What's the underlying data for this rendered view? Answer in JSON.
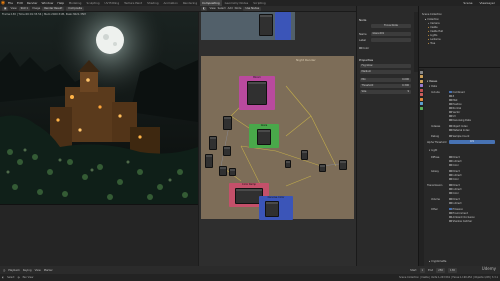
{
  "app": {
    "logo": "blender-logo",
    "menus": [
      "File",
      "Edit",
      "Render",
      "Window",
      "Help"
    ],
    "workspaces": [
      "Modeling",
      "Sculpting",
      "UV Editing",
      "Texture Paint",
      "Shading",
      "Animation",
      "Rendering",
      "Compositing",
      "Geometry Nodes",
      "Scripting"
    ],
    "active_workspace": "Compositing",
    "scene": "Scene",
    "view_layer": "ViewLayer"
  },
  "viewport": {
    "toolbar": [
      "View",
      "Slot 1",
      "Image",
      "Render Result"
    ],
    "mode_items": [
      "Composite"
    ],
    "info": "Frame:130 | Time:00:01:33.54 | Mem:2400.51M, Peak:3621.35M"
  },
  "node_editor": {
    "header_items": [
      "View",
      "Select",
      "Add",
      "Node",
      "Use Nodes"
    ],
    "breadcrumb": "Scene > Compositing Node Tree",
    "canvas_label": "Night Render",
    "frames": [
      {
        "title": "Bloom",
        "color": "#b94a9e"
      },
      {
        "title": "Glare",
        "color": "#49a84a"
      },
      {
        "title": "Color Ramp",
        "color": "#c4506a"
      },
      {
        "title": "Denoise Color",
        "color": "#3b55b8"
      }
    ]
  },
  "n_panel": {
    "node_section": "Node",
    "name_label": "Name",
    "name_value": "Glare.001",
    "label_label": "Label",
    "label_value": "",
    "color_label": "Color",
    "properties_section": "Properties",
    "fields": [
      {
        "label": "Fog Glow",
        "value": ""
      },
      {
        "label": "Medium",
        "value": ""
      },
      {
        "label": "Mix",
        "value": "0.000"
      },
      {
        "label": "Threshold",
        "value": "0.300"
      },
      {
        "label": "Size",
        "value": "9"
      }
    ],
    "focus_btn": "Focus Node"
  },
  "outliner": {
    "title": "Scene Collection",
    "rows": [
      "Collection",
      "Camera",
      "Castle",
      "Castle Hall",
      "Lights",
      "Lanterns",
      "Tree"
    ]
  },
  "properties": {
    "header": "Passes",
    "data_label": "Data",
    "include_label": "Include",
    "include": [
      {
        "label": "Combined",
        "on": true
      },
      {
        "label": "Z",
        "on": false
      },
      {
        "label": "Mist",
        "on": false
      },
      {
        "label": "Position",
        "on": false
      },
      {
        "label": "Normal",
        "on": false
      },
      {
        "label": "Vector",
        "on": false
      },
      {
        "label": "UV",
        "on": false
      },
      {
        "label": "Denoising Data",
        "on": false
      }
    ],
    "indexes_label": "Indexes",
    "indexes": [
      {
        "label": "Object Index",
        "on": false
      },
      {
        "label": "Material Index",
        "on": false
      }
    ],
    "debug_label": "Debug",
    "debug_value": "Sample Count",
    "alpha_label": "Alpha Threshold",
    "alpha_value": "0.5",
    "light_label": "Light",
    "diffuse_label": "Diffuse",
    "diffuse": [
      "Direct",
      "Indirect",
      "Color"
    ],
    "glossy_label": "Glossy",
    "glossy": [
      "Direct",
      "Indirect",
      "Color"
    ],
    "transmission_label": "Transmission",
    "transmission": [
      "Direct",
      "Indirect",
      "Color"
    ],
    "volume_label": "Volume",
    "volume": [
      "Direct",
      "Indirect"
    ],
    "other_label": "Other",
    "other": [
      {
        "label": "Emission",
        "on": true
      },
      {
        "label": "Environment",
        "on": false
      },
      {
        "label": "Ambient Occlusion",
        "on": false
      },
      {
        "label": "Shadow Catcher",
        "on": false
      }
    ],
    "crypto_label": "Cryptomatte"
  },
  "timeline": {
    "items": [
      "Playback",
      "Keying",
      "View",
      "Marker"
    ],
    "start_label": "Start",
    "start": "1",
    "end_label": "End",
    "end": "250",
    "current": "130"
  },
  "statusbar": {
    "left": "Select",
    "mid": "Pan View",
    "right": "Scene Collection | Castle | Verts:1,243,561 | Faces:1,190,452 | Objects:1/28 | 3.3.1",
    "watermark": "Udemy"
  }
}
